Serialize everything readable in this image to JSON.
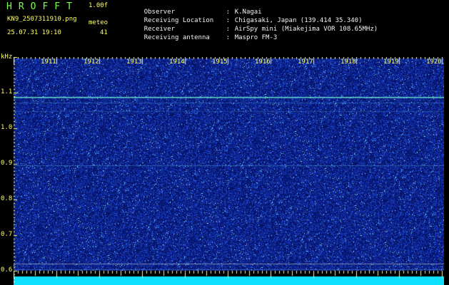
{
  "header": {
    "app_title": "HROFFT",
    "version": "1.00f",
    "filename": "KN9_2507311910.png",
    "meteo_label": "meteo",
    "datetime": "25.07.31 19:10",
    "count": "41"
  },
  "info": [
    {
      "label": "Observer",
      "value": "K.Nagai"
    },
    {
      "label": "Receiving Location",
      "value": "Chigasaki, Japan (139.414 35.340)"
    },
    {
      "label": "Receiver",
      "value": "AirSpy mini (Miakejima VOR 108.65MHz)"
    },
    {
      "label": "Receiving antenna",
      "value": "Maspro FM-3"
    }
  ],
  "spectrogram": {
    "y_unit": "kHz",
    "y_labels": [
      "1.1",
      "1.0",
      "0.9",
      "0.8",
      "0.7",
      "0.6"
    ],
    "minute_ticks": [
      "1911",
      "1912",
      "1913",
      "1914",
      "1915",
      "1916",
      "1917",
      "1918",
      "1919",
      "1920"
    ],
    "colors": {
      "background": "#0a1f8c",
      "noise": "#2a4fd8",
      "signal": "#6ff0d0",
      "band": "#0fe0ff",
      "text_yellow": "#ffff66",
      "text_green": "#7cff4c"
    }
  }
}
